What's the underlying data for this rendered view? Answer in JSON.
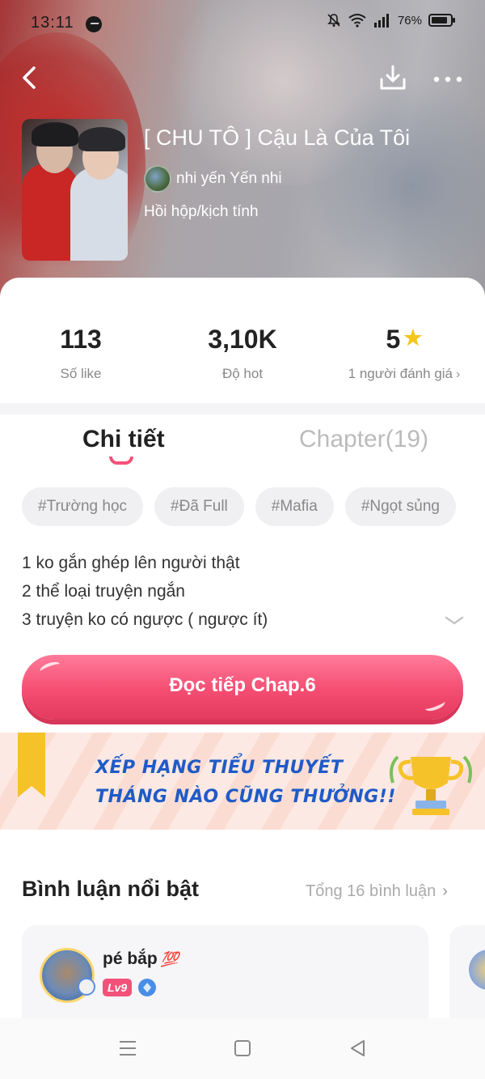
{
  "status_bar": {
    "time": "13:11",
    "battery_percent": "76%",
    "icons": [
      "messenger-icon",
      "mute-icon",
      "wifi-icon",
      "signal-icon",
      "battery-icon"
    ]
  },
  "header": {
    "back_icon": "chevron-left-icon",
    "download_icon": "download-icon",
    "more_icon": "more-dots-icon"
  },
  "story": {
    "title": "[ CHU TÔ ] Cậu Là Của Tôi",
    "author": "nhi yến Yến nhi",
    "genre": "Hồi hộp/kịch tính"
  },
  "stats": [
    {
      "value": "113",
      "label": "Số like"
    },
    {
      "value": "3,10K",
      "label": "Độ hot"
    },
    {
      "value": "5",
      "label": "1 người đánh giá"
    }
  ],
  "tabs": {
    "detail": "Chi tiết",
    "chapter": "Chapter(19)"
  },
  "tags": [
    "#Trường học",
    "#Đã Full",
    "#Mafia",
    "#Ngọt sủng"
  ],
  "description": [
    "1 ko gắn ghép lên người thật",
    "2 thể loại truyện ngắn",
    "3 truyện ko có ngược ( ngược ít)"
  ],
  "read_button": "Đọc tiếp Chap.6",
  "banner": {
    "line1": "XẾP HẠNG TIỂU THUYẾT",
    "line2": "THÁNG NÀO CŨNG THƯỞNG!!"
  },
  "comments": {
    "section_title": "Bình luận nổi bật",
    "total": "Tổng 16 bình luận",
    "items": [
      {
        "name": "pé bắp",
        "emoji": "💯",
        "level": "Lv9"
      }
    ]
  },
  "colors": {
    "accent": "#f2527a",
    "star": "#f5c518",
    "banner_text": "#1f5bc7"
  }
}
